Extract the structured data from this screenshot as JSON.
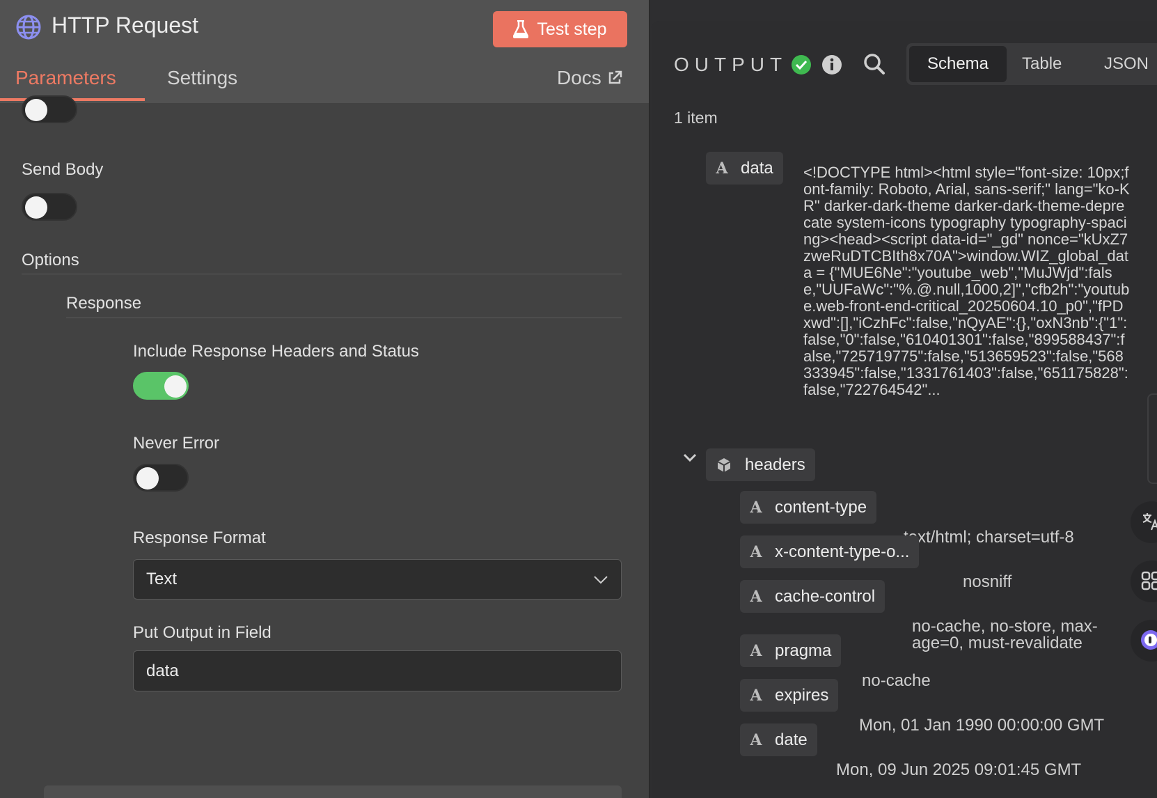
{
  "header": {
    "title": "HTTP Request",
    "test_label": "Test step"
  },
  "tabs": {
    "parameters": "Parameters",
    "settings": "Settings",
    "docs": "Docs"
  },
  "params": {
    "send_body_label": "Send Body",
    "options_label": "Options",
    "response_label": "Response",
    "include_headers_label": "Include Response Headers and Status",
    "include_headers_on": true,
    "never_error_label": "Never Error",
    "never_error_on": false,
    "response_format_label": "Response Format",
    "response_format_value": "Text",
    "put_output_label": "Put Output in Field",
    "put_output_value": "data"
  },
  "output": {
    "title": "OUTPUT",
    "views": [
      "Schema",
      "Table",
      "JSON"
    ],
    "active_view": "Schema",
    "item_count": "1 item",
    "data_key": "data",
    "data_value": "<!DOCTYPE html><html style=\"font-size: 10px;font-family: Roboto, Arial, sans-serif;\" lang=\"ko-KR\" darker-dark-theme darker-dark-theme-deprecate system-icons typography typography-spacing><head><script data-id=\"_gd\" nonce=\"kUxZ7zweRuDTCBIth8x70A\">window.WIZ_global_data = {\"MUE6Ne\":\"youtube_web\",\"MuJWjd\":false,\"UUFaWc\":\"%.@.null,1000,2]\",\"cfb2h\":\"youtube.web-front-end-critical_20250604.10_p0\",\"fPDxwd\":[],\"iCzhFc\":false,\"nQyAE\":{},\"oxN3nb\":{\"1\":false,\"0\":false,\"610401301\":false,\"899588437\":false,\"725719775\":false,\"513659523\":false,\"568333945\":false,\"1331761403\":false,\"651175828\":false,\"722764542\"...",
    "headers_key": "headers",
    "headers": [
      {
        "key": "content-type",
        "value": "text/html; charset=utf-8"
      },
      {
        "key": "x-content-type-o...",
        "value": "nosniff"
      },
      {
        "key": "cache-control",
        "value": "no-cache, no-store, max-age=0, must-revalidate"
      },
      {
        "key": "pragma",
        "value": "no-cache"
      },
      {
        "key": "expires",
        "value": "Mon, 01 Jan 1990 00:00:00 GMT"
      },
      {
        "key": "date",
        "value": "Mon, 09 Jun 2025 09:01:45 GMT"
      }
    ]
  },
  "colors": {
    "accent": "#ea7360",
    "toggle_on": "#5ac468",
    "success": "#3fb950"
  }
}
